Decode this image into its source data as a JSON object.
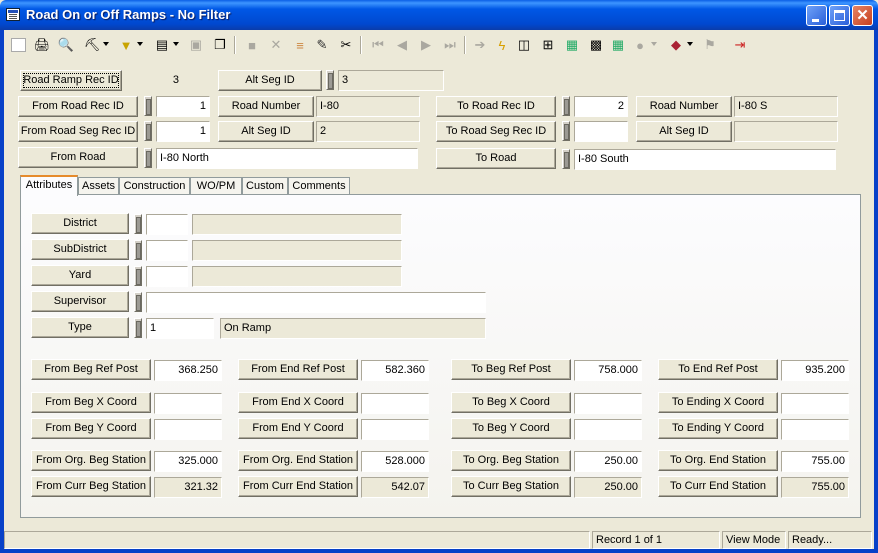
{
  "window": {
    "title": "Road On or Off Ramps - No Filter",
    "close_glyph": "✕"
  },
  "toolbar": {
    "icons": [
      "new-record-icon",
      "print-icon",
      "print-preview-icon",
      "find-icon",
      "filter-icon",
      "view-icon",
      "copy-record-icon",
      "paste-record-icon",
      "save-icon",
      "delete-icon",
      "attach-icon",
      "edit-icon",
      "cut-icon",
      "first-record-icon",
      "previous-record-icon",
      "next-record-icon",
      "last-record-icon",
      "goto-icon",
      "run-icon",
      "window-icon",
      "tree-icon",
      "map-icon",
      "calculator-icon",
      "grid-map-icon",
      "chat-icon",
      "book-icon",
      "flag-icon",
      "exit-icon"
    ]
  },
  "header": {
    "road_ramp_rec_id": {
      "label": "Road Ramp Rec ID",
      "value": "3"
    },
    "alt_seg_id": {
      "label": "Alt Seg ID",
      "value": "3"
    },
    "from": {
      "road_rec_id": {
        "label": "From Road Rec ID",
        "value": "1"
      },
      "road_number": {
        "label": "Road Number",
        "value": "I-80"
      },
      "road_seg_rec_id": {
        "label": "From Road Seg Rec ID",
        "value": "1"
      },
      "alt_seg_id": {
        "label": "Alt Seg ID",
        "value": "2"
      },
      "road": {
        "label": "From Road",
        "value": "I-80 North"
      }
    },
    "to": {
      "road_rec_id": {
        "label": "To Road Rec ID",
        "value": "2"
      },
      "road_number": {
        "label": "Road Number",
        "value": "I-80 S"
      },
      "road_seg_rec_id": {
        "label": "To Road Seg Rec ID",
        "value": ""
      },
      "alt_seg_id": {
        "label": "Alt Seg ID",
        "value": ""
      },
      "road": {
        "label": "To Road",
        "value": "I-80 South"
      }
    }
  },
  "tabs": [
    "Attributes",
    "Assets",
    "Construction",
    "WO/PM",
    "Custom",
    "Comments"
  ],
  "attributes": {
    "district": {
      "label": "District",
      "code": "",
      "desc": ""
    },
    "subdistrict": {
      "label": "SubDistrict",
      "code": "",
      "desc": ""
    },
    "yard": {
      "label": "Yard",
      "code": "",
      "desc": ""
    },
    "supervisor": {
      "label": "Supervisor",
      "value": ""
    },
    "type": {
      "label": "Type",
      "code": "1",
      "desc": "On Ramp"
    }
  },
  "grid": {
    "from_beg_ref_post": {
      "label": "From Beg Ref Post",
      "value": "368.250"
    },
    "from_end_ref_post": {
      "label": "From End Ref Post",
      "value": "582.360"
    },
    "to_beg_ref_post": {
      "label": "To Beg Ref Post",
      "value": "758.000"
    },
    "to_end_ref_post": {
      "label": "To End Ref Post",
      "value": "935.200"
    },
    "from_beg_x": {
      "label": "From Beg X Coord",
      "value": ""
    },
    "from_end_x": {
      "label": "From End X Coord",
      "value": ""
    },
    "to_beg_x": {
      "label": "To Beg X Coord",
      "value": ""
    },
    "to_ending_x": {
      "label": "To Ending X Coord",
      "value": ""
    },
    "from_beg_y": {
      "label": "From Beg Y Coord",
      "value": ""
    },
    "from_end_y": {
      "label": "From End Y Coord",
      "value": ""
    },
    "to_beg_y": {
      "label": "To Beg Y Coord",
      "value": ""
    },
    "to_ending_y": {
      "label": "To Ending Y Coord",
      "value": ""
    },
    "from_org_beg_station": {
      "label": "From Org. Beg Station",
      "value": "325.000"
    },
    "from_org_end_station": {
      "label": "From Org. End Station",
      "value": "528.000"
    },
    "to_org_beg_station": {
      "label": "To Org. Beg Station",
      "value": "250.00"
    },
    "to_org_end_station": {
      "label": "To Org. End Station",
      "value": "755.00"
    },
    "from_curr_beg_station": {
      "label": "From Curr Beg Station",
      "value": "321.32"
    },
    "from_curr_end_station": {
      "label": "From Curr End Station",
      "value": "542.07"
    },
    "to_curr_beg_station": {
      "label": "To Curr Beg Station",
      "value": "250.00"
    },
    "to_curr_end_station": {
      "label": "To Curr End Station",
      "value": "755.00"
    }
  },
  "status": {
    "record": "Record 1 of 1",
    "mode": "View Mode",
    "state": "Ready..."
  }
}
